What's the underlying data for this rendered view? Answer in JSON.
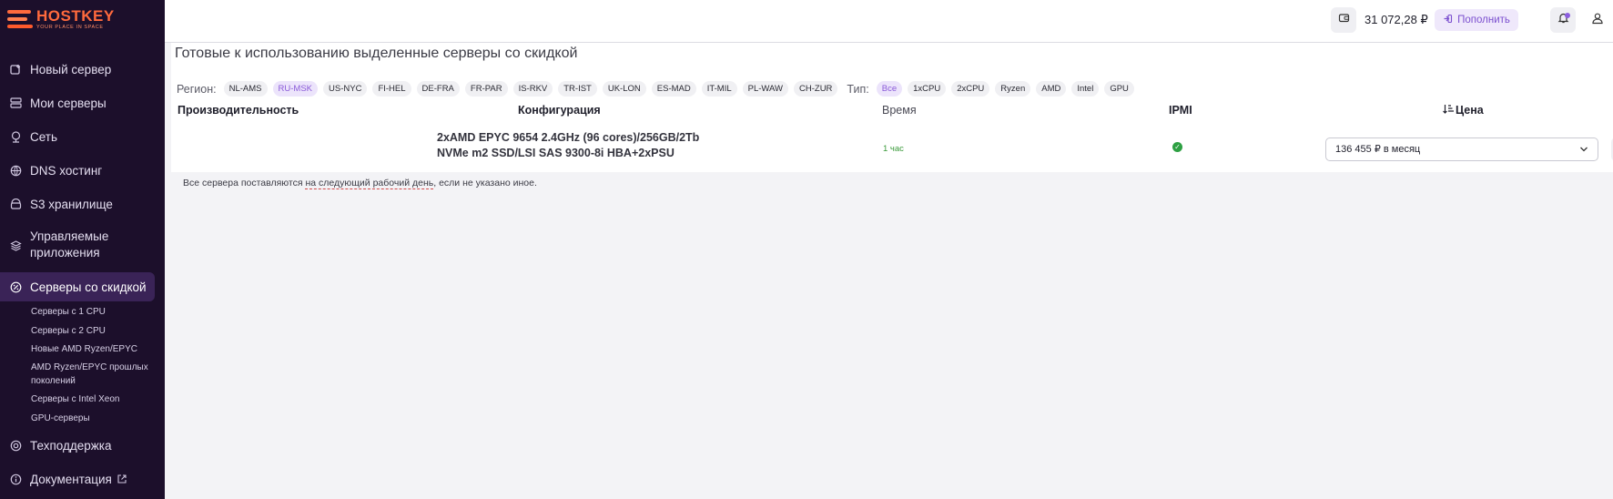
{
  "brand": {
    "name": "HOSTKEY",
    "tagline": "YOUR PLACE IN SPACE"
  },
  "sidebar": {
    "items": [
      {
        "label": "Новый сервер",
        "icon": "new-server-icon"
      },
      {
        "label": "Мои серверы",
        "icon": "servers-icon"
      },
      {
        "label": "Сеть",
        "icon": "network-icon"
      },
      {
        "label": "DNS хостинг",
        "icon": "dns-icon"
      },
      {
        "label": "S3 хранилище",
        "icon": "storage-icon"
      },
      {
        "label": "Управляемые приложения",
        "icon": "stack-icon"
      },
      {
        "label": "Серверы со скидкой",
        "icon": "discount-icon"
      },
      {
        "label": "Техподдержка",
        "icon": "support-icon"
      },
      {
        "label": "Документация",
        "icon": "info-icon"
      }
    ],
    "subitems": [
      "Серверы с 1 CPU",
      "Серверы с 2 CPU",
      "Новые AMD Ryzen/EPYC",
      "AMD Ryzen/EPYC прошлых поколений",
      "Серверы с Intel Xeon",
      "GPU-серверы"
    ]
  },
  "header": {
    "balance": "31 072,28 ₽",
    "topup_label": "Пополнить"
  },
  "main": {
    "title": "Готовые к использованию выделенные серверы со скидкой",
    "region_label": "Регион:",
    "regions": [
      "NL-AMS",
      "RU-MSK",
      "US-NYC",
      "FI-HEL",
      "DE-FRA",
      "FR-PAR",
      "IS-RKV",
      "TR-IST",
      "UK-LON",
      "ES-MAD",
      "IT-MIL",
      "PL-WAW",
      "CH-ZUR"
    ],
    "active_region": "RU-MSK",
    "type_label": "Тип:",
    "types": [
      "Все",
      "1xCPU",
      "2xCPU",
      "Ryzen",
      "AMD",
      "Intel",
      "GPU"
    ],
    "active_type": "Все",
    "columns": {
      "performance": "Производительность",
      "configuration": "Конфигурация",
      "time": "Время",
      "ipmi": "IPMI",
      "price": "Цена"
    },
    "rows": [
      {
        "config_line1": "2xAMD EPYC 9654 2.4GHz (96 cores)/256GB/2Tb",
        "config_line2": "NVMe m2 SSD/LSI SAS 9300-8i HBA+2xPSU",
        "time": "1 час",
        "ipmi": true,
        "price": "136 455 ₽ в месяц"
      }
    ],
    "note_prefix": "Все сервера поставляются ",
    "note_link": "на следующий рабочий день",
    "note_suffix": ", если не указано иное."
  },
  "colors": {
    "sidebar_bg": "#1c0f2b",
    "accent": "#8a5ad8",
    "brand_orange": "#ff6a3d",
    "success": "#2ea043"
  }
}
